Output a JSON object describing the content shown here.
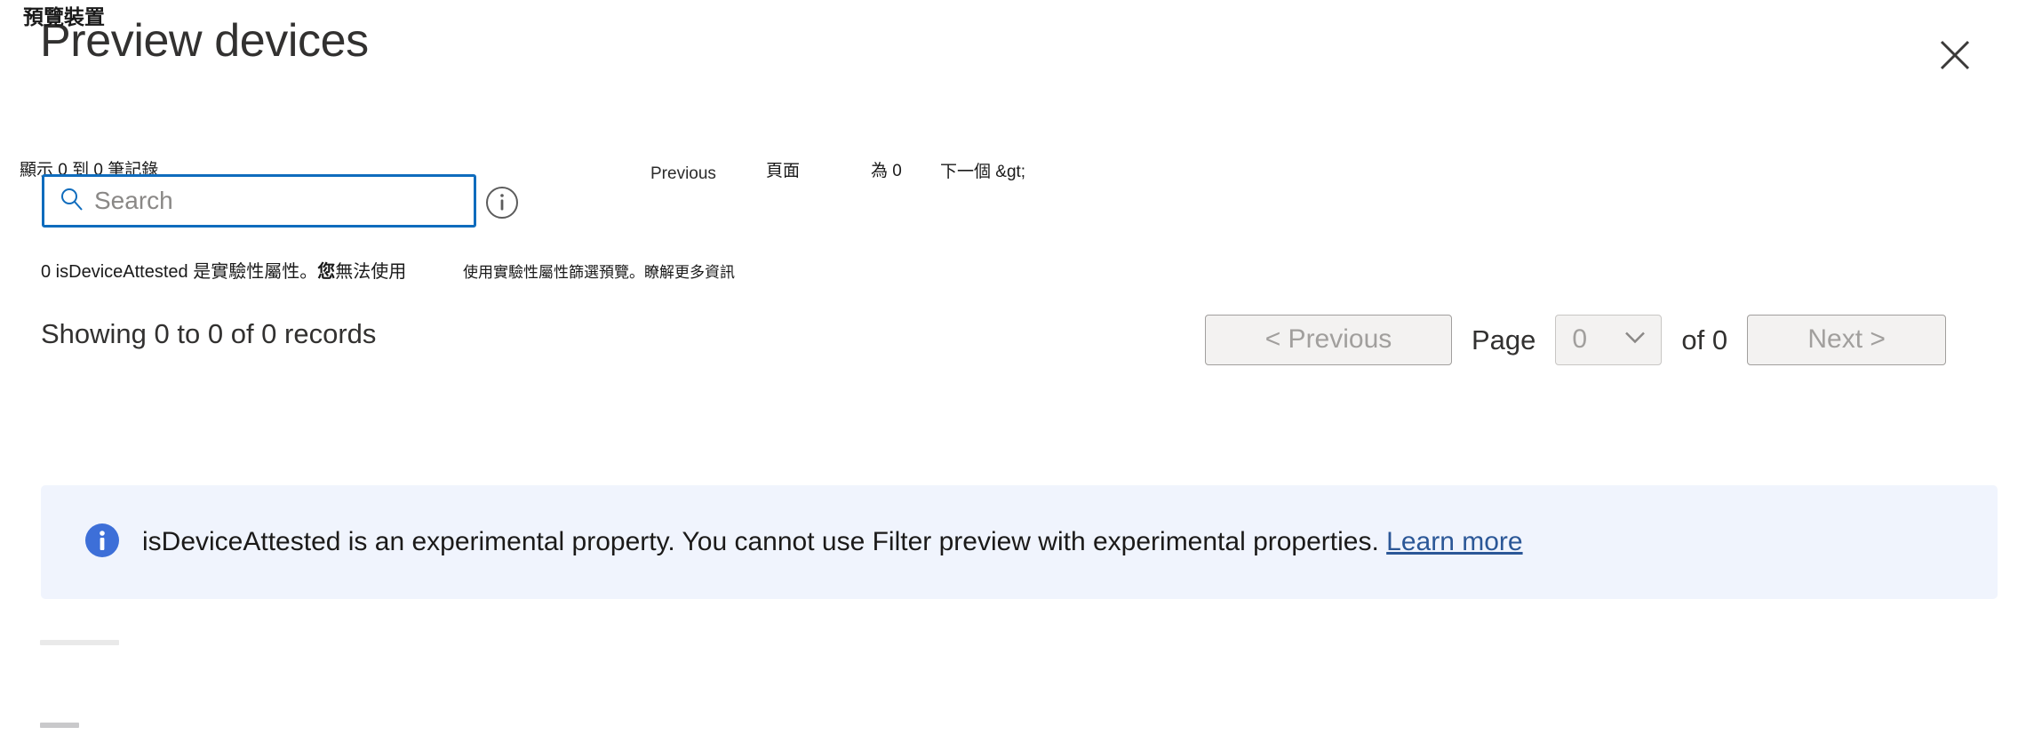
{
  "header": {
    "title": "Preview devices",
    "title_overlay": "預覽裝置",
    "close_label": "close-icon"
  },
  "translation_overlay": {
    "showing_records": "顯示 0 到 0 筆記錄",
    "previous": "Previous",
    "page": "頁面",
    "of": "為 0",
    "next": "下一個 &gt;",
    "experimental_prefix": "0 isDeviceAttested",
    "experimental_rest": "是實驗性屬性。",
    "experimental_bold": "您",
    "experimental_tail": "無法使用",
    "experimental_second": "使用實驗性屬性篩選預覽。瞭解更多資訊"
  },
  "search": {
    "placeholder": "Search",
    "value": "",
    "icon": "search-icon",
    "info_icon": "info-circle-outline-icon"
  },
  "results": {
    "records_label": "Showing 0 to 0 of 0 records"
  },
  "pagination": {
    "previous_label": "< Previous",
    "page_label": "Page",
    "page_value": "0",
    "of_label": "of 0",
    "next_label": "Next >",
    "chevron_icon": "chevron-down-icon"
  },
  "banner": {
    "icon": "info-circle-filled-icon",
    "message": "isDeviceAttested is an experimental property. You cannot use Filter preview with experimental properties.",
    "link_label": "Learn more",
    "background": "#f0f4fd",
    "icon_color": "#3d6fd8",
    "link_color": "#2b5797"
  },
  "colors": {
    "accent": "#0f6cbd",
    "text": "#323130",
    "disabled_text": "#a19f9d",
    "button_bg": "#f3f2f1"
  }
}
